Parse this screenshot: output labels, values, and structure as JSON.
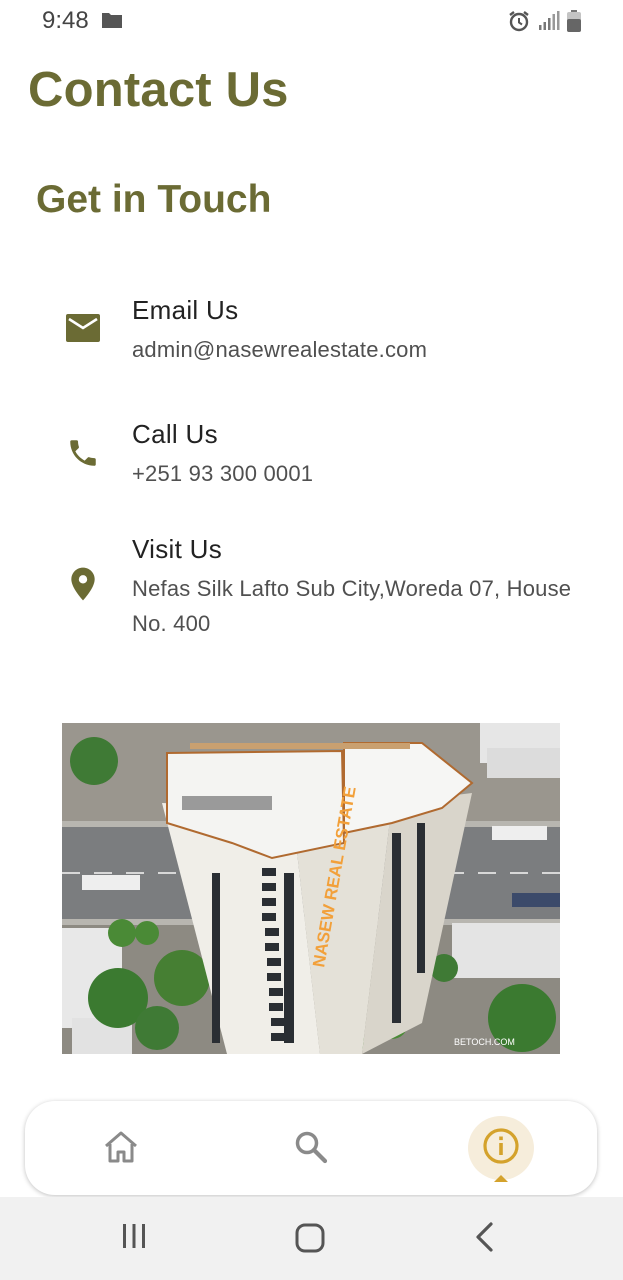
{
  "status_bar": {
    "time": "9:48"
  },
  "page": {
    "title": "Contact Us",
    "section_title": "Get in Touch"
  },
  "contacts": [
    {
      "icon": "email-icon",
      "title": "Email Us",
      "value": "admin@nasewrealestate.com"
    },
    {
      "icon": "phone-icon",
      "title": "Call Us",
      "value": "+251 93 300 0001"
    },
    {
      "icon": "location-pin-icon",
      "title": "Visit Us",
      "value": "Nefas Silk Lafto Sub City,Woreda 07, House No. 400"
    }
  ],
  "image": {
    "sign_text": "NASEW REAL ESTATE",
    "watermark": "BETOCH.COM"
  },
  "bottom_nav": {
    "items": [
      {
        "icon": "home-icon",
        "active": false
      },
      {
        "icon": "search-icon",
        "active": false
      },
      {
        "icon": "info-icon",
        "active": true
      }
    ]
  },
  "colors": {
    "brand": "#6b6b34",
    "active_nav": "#d4a22c",
    "active_nav_bg": "#f6eddb"
  }
}
